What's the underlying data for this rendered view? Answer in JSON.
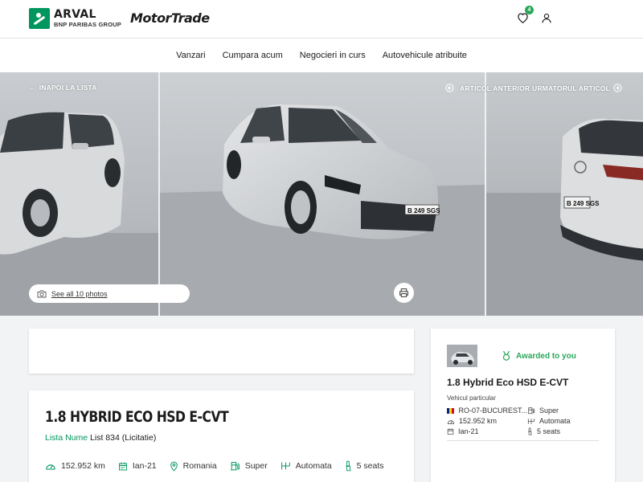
{
  "header": {
    "brand_name": "ARVAL",
    "brand_sub": "BNP PARIBAS GROUP",
    "partner": "MotorTrade",
    "favorites_count": "4",
    "icons": [
      "heart-icon",
      "user-icon"
    ]
  },
  "nav": {
    "items": [
      "Vanzari",
      "Cumpara acum",
      "Negocieri in curs",
      "Autovehicule atribuite"
    ]
  },
  "gallery": {
    "back_label": "INAPOI LA LISTA",
    "prev_label": "ARTICOL ANTERIOR",
    "next_label": "URMATORUL ARTICOL",
    "see_all_label": "See all 10 photos",
    "plate": "B 249 SGS"
  },
  "vehicle": {
    "title": "1.8 HYBRID ECO HSD E-CVT",
    "list_label": "Lista Nume",
    "list_value": "List 834 (Licitatie)",
    "specs": {
      "mileage": "152.952 km",
      "date": "Ian-21",
      "location": "Romania",
      "fuel": "Super",
      "gearbox": "Automata",
      "seats": "5 seats"
    }
  },
  "summary": {
    "awarded_label": "Awarded to you",
    "title": "1.8 Hybrid Eco HSD E-CVT",
    "type": "Vehicul particular",
    "location": "RO-07-BUCUREST...",
    "fuel": "Super",
    "mileage": "152.952 km",
    "gearbox": "Automata",
    "date": "Ian-21",
    "seats": "5 seats"
  },
  "colors": {
    "brand_green": "#00965e",
    "accent_green": "#2aa85a"
  }
}
